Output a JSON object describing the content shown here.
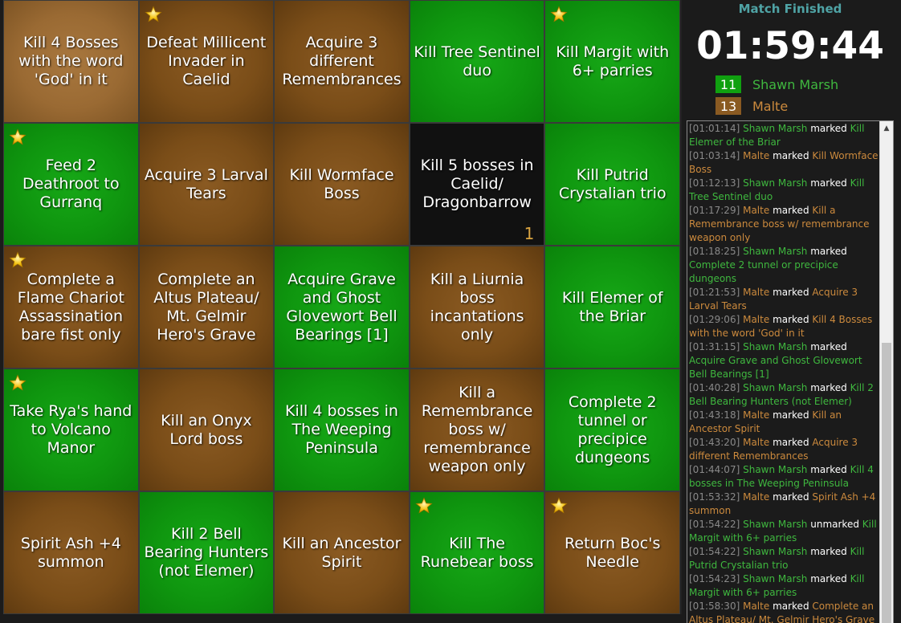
{
  "board": {
    "cells": [
      {
        "text": "Kill 4 Bosses with the word 'God' in it",
        "state": "hover-brown",
        "star": false,
        "counter": ""
      },
      {
        "text": "Defeat Millicent Invader in Caelid",
        "state": "brown",
        "star": true,
        "counter": ""
      },
      {
        "text": "Acquire 3 different Remembrances",
        "state": "brown",
        "star": false,
        "counter": ""
      },
      {
        "text": "Kill Tree Sentinel duo",
        "state": "green",
        "star": false,
        "counter": ""
      },
      {
        "text": "Kill Margit with 6+ parries",
        "state": "green",
        "star": true,
        "counter": ""
      },
      {
        "text": "Feed 2 Deathroot to Gurranq",
        "state": "green",
        "star": true,
        "counter": ""
      },
      {
        "text": "Acquire 3 Larval Tears",
        "state": "brown",
        "star": false,
        "counter": ""
      },
      {
        "text": "Kill Wormface Boss",
        "state": "brown",
        "star": false,
        "counter": ""
      },
      {
        "text": "Kill 5 bosses in Caelid/ Dragonbarrow",
        "state": "black",
        "star": false,
        "counter": "1"
      },
      {
        "text": "Kill Putrid Crystalian trio",
        "state": "green",
        "star": false,
        "counter": ""
      },
      {
        "text": "Complete a Flame Chariot Assassination bare fist only",
        "state": "brown",
        "star": true,
        "counter": ""
      },
      {
        "text": "Complete an Altus Plateau/ Mt. Gelmir Hero's Grave",
        "state": "brown",
        "star": false,
        "counter": ""
      },
      {
        "text": "Acquire Grave and Ghost Glovewort Bell Bearings [1]",
        "state": "green",
        "star": false,
        "counter": ""
      },
      {
        "text": "Kill a Liurnia boss incantations only",
        "state": "brown",
        "star": false,
        "counter": ""
      },
      {
        "text": "Kill Elemer of the Briar",
        "state": "green",
        "star": false,
        "counter": ""
      },
      {
        "text": "Take Rya's hand to Volcano Manor",
        "state": "green",
        "star": true,
        "counter": ""
      },
      {
        "text": "Kill an Onyx Lord boss",
        "state": "brown",
        "star": false,
        "counter": ""
      },
      {
        "text": "Kill 4 bosses in The Weeping Peninsula",
        "state": "green",
        "star": false,
        "counter": ""
      },
      {
        "text": "Kill a Remembrance boss w/ remembrance weapon only",
        "state": "brown",
        "star": false,
        "counter": ""
      },
      {
        "text": "Complete 2 tunnel or precipice dungeons",
        "state": "green",
        "star": false,
        "counter": ""
      },
      {
        "text": "Spirit Ash +4 summon",
        "state": "brown",
        "star": false,
        "counter": ""
      },
      {
        "text": "Kill 2 Bell Bearing Hunters (not Elemer)",
        "state": "green",
        "star": false,
        "counter": ""
      },
      {
        "text": "Kill an Ancestor Spirit",
        "state": "brown",
        "star": false,
        "counter": ""
      },
      {
        "text": "Kill The Runebear boss",
        "state": "green",
        "star": true,
        "counter": ""
      },
      {
        "text": "Return Boc's Needle",
        "state": "brown",
        "star": true,
        "counter": ""
      }
    ]
  },
  "status": "Match Finished",
  "timer": "01:59:44",
  "players": [
    {
      "score": "11",
      "name": "Shawn Marsh",
      "color": "#10a010",
      "text_color": "#3fb83f"
    },
    {
      "score": "13",
      "name": "Malte",
      "color": "#8a5a22",
      "text_color": "#cc8a3d"
    }
  ],
  "log": [
    {
      "time": "[01:01:14]",
      "player": "Shawn Marsh",
      "pclass": "pg",
      "action": "marked",
      "goal": "Kill Elemer of the Briar"
    },
    {
      "time": "[01:03:14]",
      "player": "Malte",
      "pclass": "pb",
      "action": "marked",
      "goal": "Kill Wormface Boss"
    },
    {
      "time": "[01:12:13]",
      "player": "Shawn Marsh",
      "pclass": "pg",
      "action": "marked",
      "goal": "Kill Tree Sentinel duo"
    },
    {
      "time": "[01:17:29]",
      "player": "Malte",
      "pclass": "pb",
      "action": "marked",
      "goal": "Kill a Remembrance boss w/ remembrance weapon only"
    },
    {
      "time": "[01:18:25]",
      "player": "Shawn Marsh",
      "pclass": "pg",
      "action": "marked",
      "goal": "Complete 2 tunnel or precipice dungeons"
    },
    {
      "time": "[01:21:53]",
      "player": "Malte",
      "pclass": "pb",
      "action": "marked",
      "goal": "Acquire 3 Larval Tears"
    },
    {
      "time": "[01:29:06]",
      "player": "Malte",
      "pclass": "pb",
      "action": "marked",
      "goal": "Kill 4 Bosses with the word 'God' in it"
    },
    {
      "time": "[01:31:15]",
      "player": "Shawn Marsh",
      "pclass": "pg",
      "action": "marked",
      "goal": "Acquire Grave and Ghost Glovewort Bell Bearings [1]"
    },
    {
      "time": "[01:40:28]",
      "player": "Shawn Marsh",
      "pclass": "pg",
      "action": "marked",
      "goal": "Kill 2 Bell Bearing Hunters (not Elemer)"
    },
    {
      "time": "[01:43:18]",
      "player": "Malte",
      "pclass": "pb",
      "action": "marked",
      "goal": "Kill an Ancestor Spirit"
    },
    {
      "time": "[01:43:20]",
      "player": "Malte",
      "pclass": "pb",
      "action": "marked",
      "goal": "Acquire 3 different Remembrances"
    },
    {
      "time": "[01:44:07]",
      "player": "Shawn Marsh",
      "pclass": "pg",
      "action": "marked",
      "goal": "Kill 4 bosses in The Weeping Peninsula"
    },
    {
      "time": "[01:53:32]",
      "player": "Malte",
      "pclass": "pb",
      "action": "marked",
      "goal": "Spirit Ash +4 summon"
    },
    {
      "time": "[01:54:22]",
      "player": "Shawn Marsh",
      "pclass": "pg",
      "action": "unmarked",
      "goal": "Kill Margit with 6+ parries"
    },
    {
      "time": "[01:54:22]",
      "player": "Shawn Marsh",
      "pclass": "pg",
      "action": "marked",
      "goal": "Kill Putrid Crystalian trio"
    },
    {
      "time": "[01:54:23]",
      "player": "Shawn Marsh",
      "pclass": "pg",
      "action": "marked",
      "goal": "Kill Margit with 6+ parries"
    },
    {
      "time": "[01:58:30]",
      "player": "Malte",
      "pclass": "pb",
      "action": "marked",
      "goal": "Complete an Altus Plateau/ Mt. Gelmir Hero's Grave"
    }
  ],
  "icons": {
    "star": "star-icon",
    "scroll_up": "scroll-up-arrow-icon"
  }
}
